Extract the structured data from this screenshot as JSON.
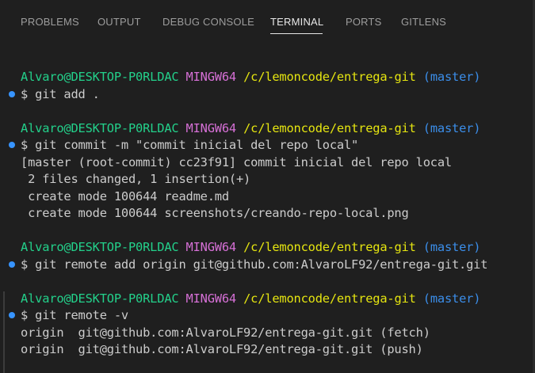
{
  "tabs": [
    {
      "label": "PROBLEMS"
    },
    {
      "label": "OUTPUT"
    },
    {
      "label": "DEBUG CONSOLE"
    },
    {
      "label": "TERMINAL"
    },
    {
      "label": "PORTS"
    },
    {
      "label": "GITLENS"
    }
  ],
  "active_tab": "TERMINAL",
  "prompt": {
    "user": "Alvaro@DESKTOP-P0RLDAC",
    "shell": "MINGW64",
    "path": "/c/lemoncode/entrega-git",
    "branch": "(master)"
  },
  "blocks": [
    {
      "command": "$ git add .",
      "output": []
    },
    {
      "command": "$ git commit -m \"commit inicial del repo local\"",
      "output": [
        "[master (root-commit) cc23f91] commit inicial del repo local",
        " 2 files changed, 1 insertion(+)",
        " create mode 100644 readme.md",
        " create mode 100644 screenshots/creando-repo-local.png"
      ]
    },
    {
      "command": "$ git remote add origin git@github.com:AlvaroLF92/entrega-git.git",
      "output": []
    },
    {
      "command": "$ git remote -v",
      "output": [
        "origin  git@github.com:AlvaroLF92/entrega-git.git (fetch)",
        "origin  git@github.com:AlvaroLF92/entrega-git.git (push)"
      ]
    }
  ],
  "colors": {
    "background": "#1f1f1f",
    "user": "#23d18b",
    "shell": "#d670d6",
    "path": "#e5e510",
    "branch": "#3b8eea",
    "decoration_dot": "#3794ff"
  }
}
